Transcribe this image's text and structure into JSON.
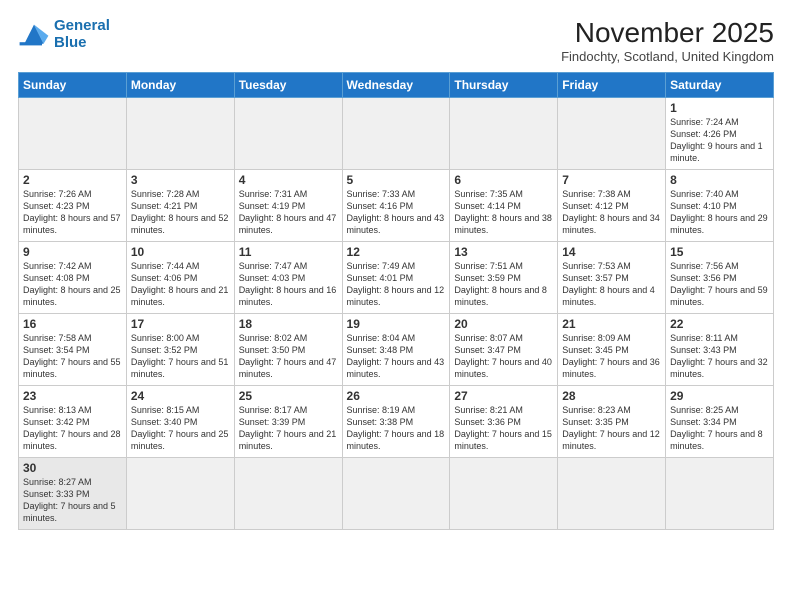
{
  "logo": {
    "line1": "General",
    "line2": "Blue"
  },
  "title": "November 2025",
  "subtitle": "Findochty, Scotland, United Kingdom",
  "weekdays": [
    "Sunday",
    "Monday",
    "Tuesday",
    "Wednesday",
    "Thursday",
    "Friday",
    "Saturday"
  ],
  "weeks": [
    [
      {
        "day": "",
        "info": ""
      },
      {
        "day": "",
        "info": ""
      },
      {
        "day": "",
        "info": ""
      },
      {
        "day": "",
        "info": ""
      },
      {
        "day": "",
        "info": ""
      },
      {
        "day": "",
        "info": ""
      },
      {
        "day": "1",
        "info": "Sunrise: 7:24 AM\nSunset: 4:26 PM\nDaylight: 9 hours and 1 minute."
      }
    ],
    [
      {
        "day": "2",
        "info": "Sunrise: 7:26 AM\nSunset: 4:23 PM\nDaylight: 8 hours and 57 minutes."
      },
      {
        "day": "3",
        "info": "Sunrise: 7:28 AM\nSunset: 4:21 PM\nDaylight: 8 hours and 52 minutes."
      },
      {
        "day": "4",
        "info": "Sunrise: 7:31 AM\nSunset: 4:19 PM\nDaylight: 8 hours and 47 minutes."
      },
      {
        "day": "5",
        "info": "Sunrise: 7:33 AM\nSunset: 4:16 PM\nDaylight: 8 hours and 43 minutes."
      },
      {
        "day": "6",
        "info": "Sunrise: 7:35 AM\nSunset: 4:14 PM\nDaylight: 8 hours and 38 minutes."
      },
      {
        "day": "7",
        "info": "Sunrise: 7:38 AM\nSunset: 4:12 PM\nDaylight: 8 hours and 34 minutes."
      },
      {
        "day": "8",
        "info": "Sunrise: 7:40 AM\nSunset: 4:10 PM\nDaylight: 8 hours and 29 minutes."
      }
    ],
    [
      {
        "day": "9",
        "info": "Sunrise: 7:42 AM\nSunset: 4:08 PM\nDaylight: 8 hours and 25 minutes."
      },
      {
        "day": "10",
        "info": "Sunrise: 7:44 AM\nSunset: 4:06 PM\nDaylight: 8 hours and 21 minutes."
      },
      {
        "day": "11",
        "info": "Sunrise: 7:47 AM\nSunset: 4:03 PM\nDaylight: 8 hours and 16 minutes."
      },
      {
        "day": "12",
        "info": "Sunrise: 7:49 AM\nSunset: 4:01 PM\nDaylight: 8 hours and 12 minutes."
      },
      {
        "day": "13",
        "info": "Sunrise: 7:51 AM\nSunset: 3:59 PM\nDaylight: 8 hours and 8 minutes."
      },
      {
        "day": "14",
        "info": "Sunrise: 7:53 AM\nSunset: 3:57 PM\nDaylight: 8 hours and 4 minutes."
      },
      {
        "day": "15",
        "info": "Sunrise: 7:56 AM\nSunset: 3:56 PM\nDaylight: 7 hours and 59 minutes."
      }
    ],
    [
      {
        "day": "16",
        "info": "Sunrise: 7:58 AM\nSunset: 3:54 PM\nDaylight: 7 hours and 55 minutes."
      },
      {
        "day": "17",
        "info": "Sunrise: 8:00 AM\nSunset: 3:52 PM\nDaylight: 7 hours and 51 minutes."
      },
      {
        "day": "18",
        "info": "Sunrise: 8:02 AM\nSunset: 3:50 PM\nDaylight: 7 hours and 47 minutes."
      },
      {
        "day": "19",
        "info": "Sunrise: 8:04 AM\nSunset: 3:48 PM\nDaylight: 7 hours and 43 minutes."
      },
      {
        "day": "20",
        "info": "Sunrise: 8:07 AM\nSunset: 3:47 PM\nDaylight: 7 hours and 40 minutes."
      },
      {
        "day": "21",
        "info": "Sunrise: 8:09 AM\nSunset: 3:45 PM\nDaylight: 7 hours and 36 minutes."
      },
      {
        "day": "22",
        "info": "Sunrise: 8:11 AM\nSunset: 3:43 PM\nDaylight: 7 hours and 32 minutes."
      }
    ],
    [
      {
        "day": "23",
        "info": "Sunrise: 8:13 AM\nSunset: 3:42 PM\nDaylight: 7 hours and 28 minutes."
      },
      {
        "day": "24",
        "info": "Sunrise: 8:15 AM\nSunset: 3:40 PM\nDaylight: 7 hours and 25 minutes."
      },
      {
        "day": "25",
        "info": "Sunrise: 8:17 AM\nSunset: 3:39 PM\nDaylight: 7 hours and 21 minutes."
      },
      {
        "day": "26",
        "info": "Sunrise: 8:19 AM\nSunset: 3:38 PM\nDaylight: 7 hours and 18 minutes."
      },
      {
        "day": "27",
        "info": "Sunrise: 8:21 AM\nSunset: 3:36 PM\nDaylight: 7 hours and 15 minutes."
      },
      {
        "day": "28",
        "info": "Sunrise: 8:23 AM\nSunset: 3:35 PM\nDaylight: 7 hours and 12 minutes."
      },
      {
        "day": "29",
        "info": "Sunrise: 8:25 AM\nSunset: 3:34 PM\nDaylight: 7 hours and 8 minutes."
      }
    ],
    [
      {
        "day": "30",
        "info": "Sunrise: 8:27 AM\nSunset: 3:33 PM\nDaylight: 7 hours and 5 minutes."
      },
      {
        "day": "",
        "info": ""
      },
      {
        "day": "",
        "info": ""
      },
      {
        "day": "",
        "info": ""
      },
      {
        "day": "",
        "info": ""
      },
      {
        "day": "",
        "info": ""
      },
      {
        "day": "",
        "info": ""
      }
    ]
  ]
}
